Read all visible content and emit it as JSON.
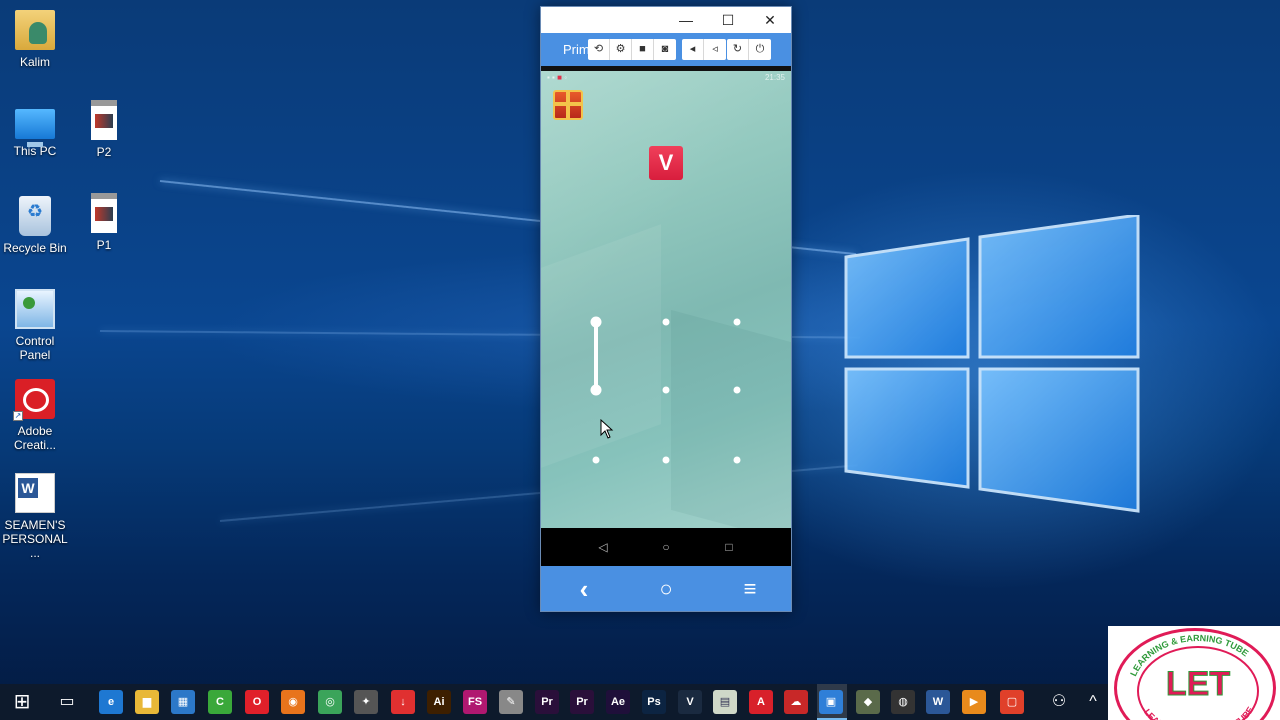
{
  "desktop": {
    "icons": [
      {
        "name": "user-folder",
        "label": "Kalim"
      },
      {
        "name": "this-pc",
        "label": "This PC"
      },
      {
        "name": "recycle-bin",
        "label": "Recycle Bin"
      },
      {
        "name": "control-panel",
        "label": "Control\nPanel"
      },
      {
        "name": "adobe-creative",
        "label": "Adobe\nCreati..."
      },
      {
        "name": "seamens-doc",
        "label": "SEAMEN'S\nPERSONAL ..."
      },
      {
        "name": "p2",
        "label": "P2"
      },
      {
        "name": "p1",
        "label": "P1"
      }
    ]
  },
  "emulator": {
    "title_visible": "Prim",
    "toolbar_icons": [
      "rotate-icon",
      "settings-icon",
      "record-icon",
      "screenshot-icon",
      "volume-down-icon",
      "volume-up-icon",
      "refresh-icon",
      "power-icon"
    ],
    "window_buttons": {
      "minimize": "—",
      "maximize": "☐",
      "close": "✕"
    },
    "status_time": "21:35",
    "app_logo_letter": "V",
    "pattern": {
      "rows": 3,
      "cols": 3,
      "drawn_path": [
        [
          0,
          0
        ],
        [
          1,
          0
        ]
      ]
    },
    "android_nav": {
      "back": "◁",
      "home": "○",
      "recents": "□"
    },
    "emulator_nav": {
      "back": "‹",
      "home": "○",
      "menu": "≡"
    }
  },
  "taskbar": {
    "apps": [
      {
        "name": "start",
        "glyph": "⊞",
        "color": "transparent"
      },
      {
        "name": "task-view",
        "glyph": "▭",
        "color": "transparent"
      },
      {
        "name": "edge",
        "glyph": "e",
        "color": "#1e78d2"
      },
      {
        "name": "file-explorer",
        "glyph": "▆",
        "color": "#e8b838"
      },
      {
        "name": "store",
        "glyph": "▦",
        "color": "#2c78c8"
      },
      {
        "name": "camtasia",
        "glyph": "C",
        "color": "#3aa83a"
      },
      {
        "name": "opera",
        "glyph": "O",
        "color": "#e0202a"
      },
      {
        "name": "firefox",
        "glyph": "◉",
        "color": "#e8741c"
      },
      {
        "name": "chrome",
        "glyph": "◎",
        "color": "#3ba45a"
      },
      {
        "name": "media",
        "glyph": "✦",
        "color": "#555"
      },
      {
        "name": "downloader",
        "glyph": "↓",
        "color": "#e03030"
      },
      {
        "name": "illustrator",
        "glyph": "Ai",
        "color": "#3d1f00"
      },
      {
        "name": "fs",
        "glyph": "FS",
        "color": "#b01870"
      },
      {
        "name": "paint",
        "glyph": "✎",
        "color": "#888"
      },
      {
        "name": "premiere",
        "glyph": "Pr",
        "color": "#2a0f3a"
      },
      {
        "name": "premiere-2",
        "glyph": "Pr",
        "color": "#2a0f3a"
      },
      {
        "name": "after-effects",
        "glyph": "Ae",
        "color": "#1f0f3a"
      },
      {
        "name": "photoshop",
        "glyph": "Ps",
        "color": "#0c2442"
      },
      {
        "name": "vegas",
        "glyph": "V",
        "color": "#1a2a40"
      },
      {
        "name": "notepad",
        "glyph": "▤",
        "color": "#cfd8c8"
      },
      {
        "name": "acrobat",
        "glyph": "A",
        "color": "#d8202a"
      },
      {
        "name": "cloud",
        "glyph": "☁",
        "color": "#c82828"
      },
      {
        "name": "emulator-app",
        "glyph": "▣",
        "color": "#2f7fd8"
      },
      {
        "name": "tool",
        "glyph": "◆",
        "color": "#5a6a4a"
      },
      {
        "name": "obs",
        "glyph": "◍",
        "color": "#333"
      },
      {
        "name": "word",
        "glyph": "W",
        "color": "#2b5797"
      },
      {
        "name": "player",
        "glyph": "▶",
        "color": "#e88a1c"
      },
      {
        "name": "camtasia-recorder",
        "glyph": "▢",
        "color": "#e0402a"
      },
      {
        "name": "people",
        "glyph": "⚇",
        "color": "transparent"
      },
      {
        "name": "tray-up",
        "glyph": "^",
        "color": "transparent"
      }
    ]
  },
  "overlay_logo": {
    "letters": "LET",
    "ring_text_top": "LEARNING & EARNING TUBE",
    "ring_text_bottom": "LEARNING & EARNING TUBE"
  }
}
